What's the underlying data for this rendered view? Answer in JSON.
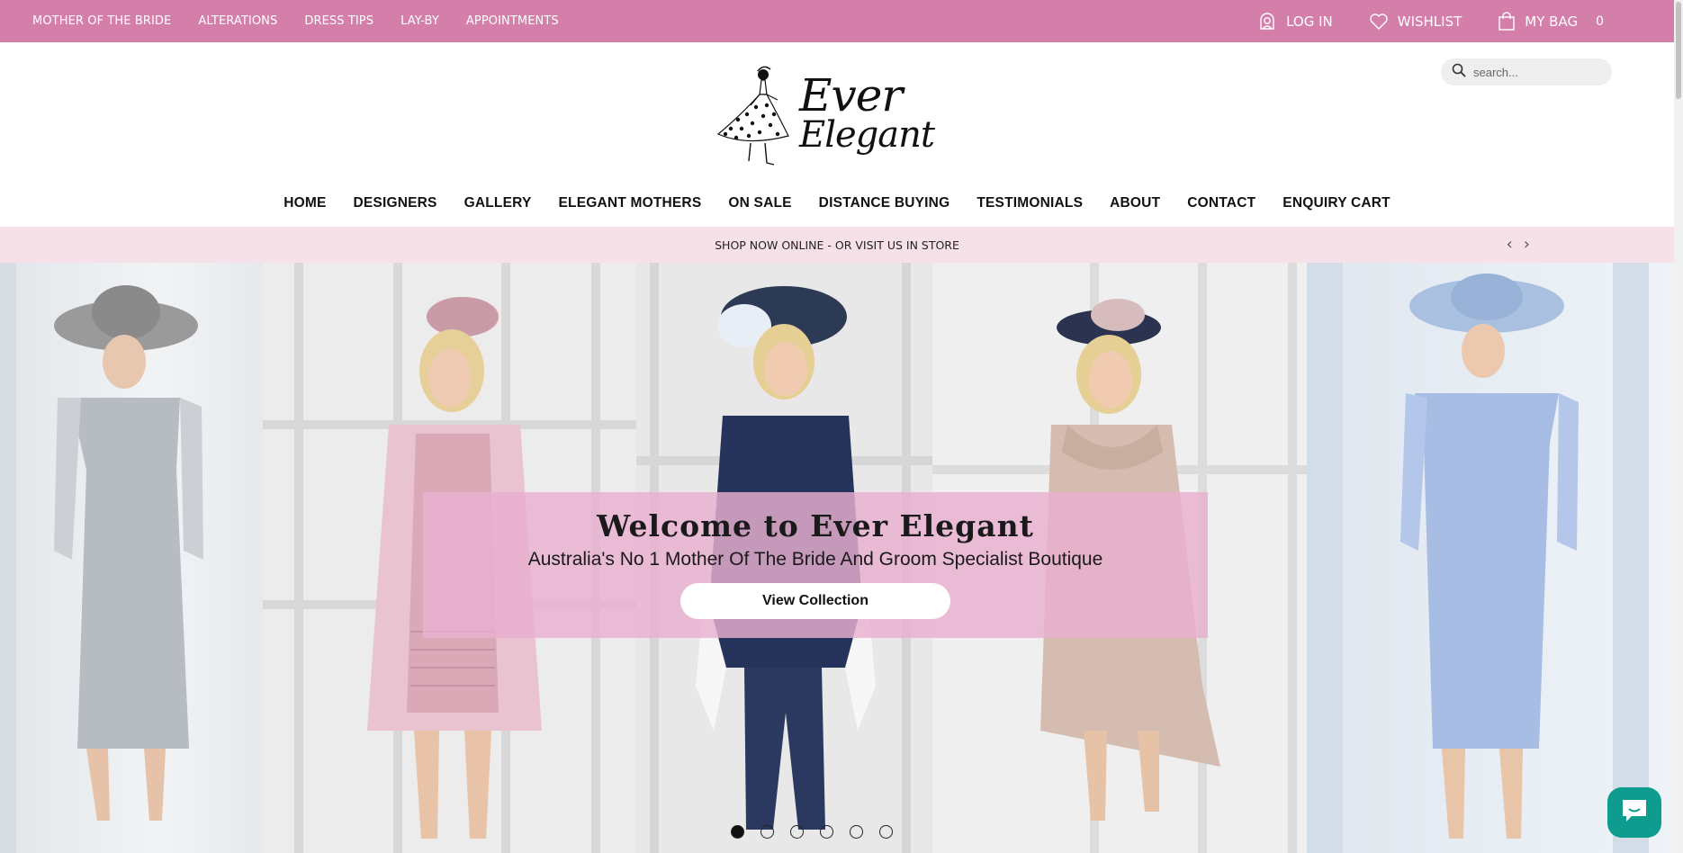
{
  "topbar": {
    "links": [
      "MOTHER OF THE BRIDE",
      "ALTERATIONS",
      "DRESS TIPS",
      "LAY-BY",
      "APPOINTMENTS"
    ],
    "login_label": "LOG IN",
    "wishlist_label": "WISHLIST",
    "bag_label": "MY BAG",
    "bag_count": "0"
  },
  "header": {
    "logo_line1": "Ever",
    "logo_line2": "Elegant",
    "search_placeholder": "search..."
  },
  "nav": {
    "items": [
      "HOME",
      "DESIGNERS",
      "GALLERY",
      "ELEGANT MOTHERS",
      "ON SALE",
      "DISTANCE BUYING",
      "TESTIMONIALS",
      "ABOUT",
      "CONTACT",
      "ENQUIRY CART"
    ]
  },
  "promo": {
    "text": "SHOP NOW ONLINE - OR VISIT US IN STORE",
    "prev": "‹",
    "next": "›"
  },
  "hero": {
    "title": "Welcome to Ever Elegant",
    "subtitle": "Australia's No 1 Mother Of The Bride And Groom Specialist Boutique",
    "button_label": "View Collection",
    "slide_count": 6,
    "active_slide": 1
  },
  "colors": {
    "topbar": "#d47fa9",
    "promo": "#f7e1e8",
    "hero_card": "#e9b0d0",
    "chat": "#0d9c8e"
  },
  "icons": [
    "user-icon",
    "heart-icon",
    "bag-icon",
    "search-icon",
    "chat-icon"
  ]
}
